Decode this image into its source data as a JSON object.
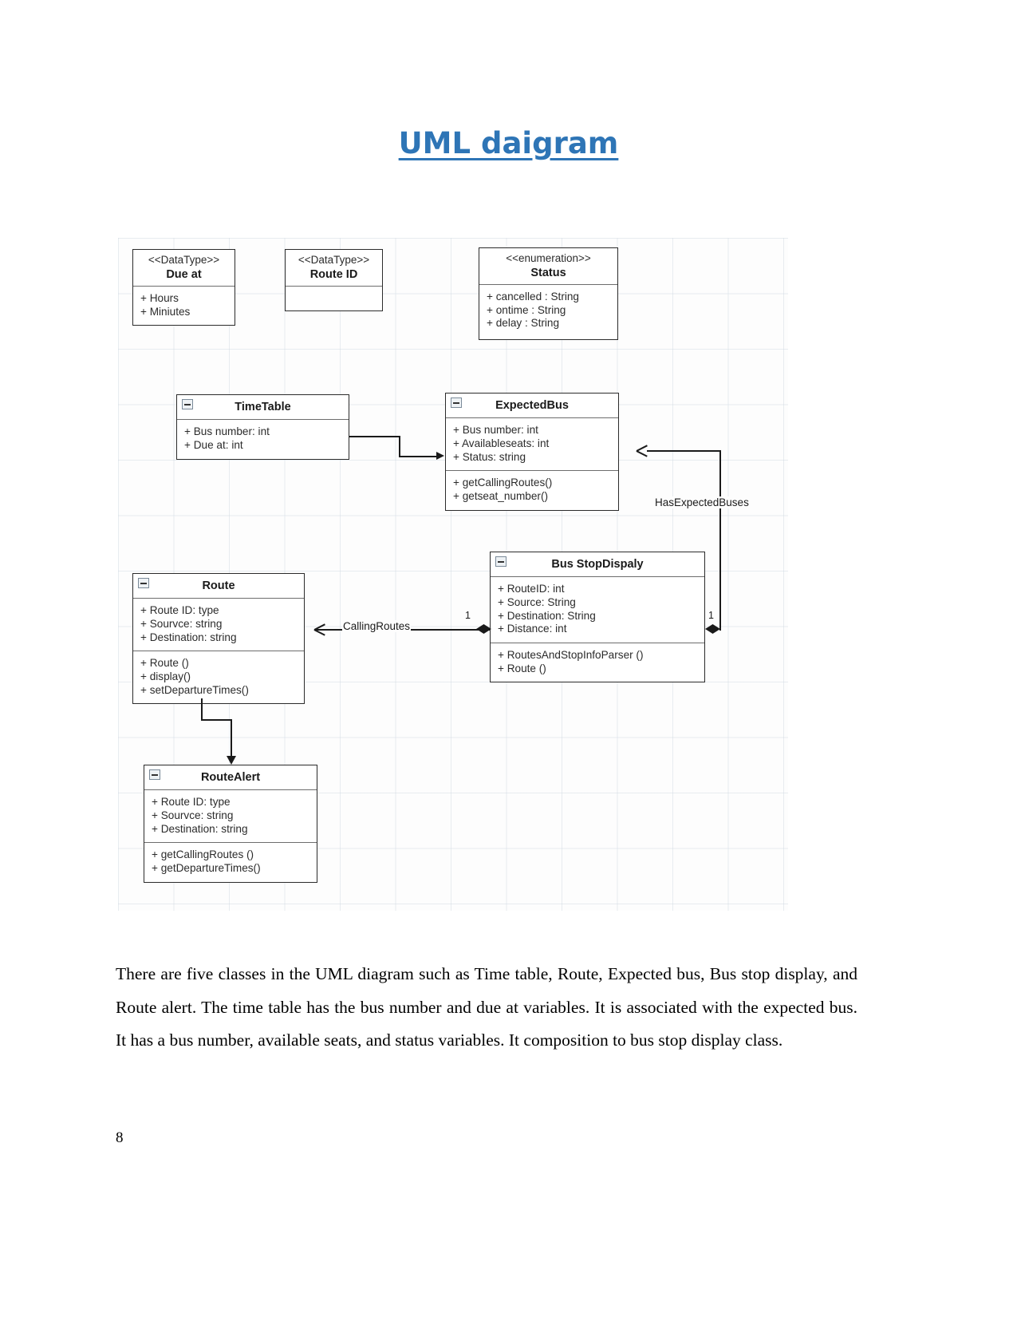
{
  "document": {
    "title": "UML daigram",
    "page_number": "8",
    "paragraph": "There are five classes in the UML diagram such as Time table, Route, Expected bus, Bus stop display, and Route alert. The time table has the bus number and due at variables. It is associated with the expected bus. It has a bus number, available seats, and status variables. It composition to bus stop display class.",
    "title_color": "#2E75B6"
  },
  "diagram": {
    "classes": [
      {
        "id": "dueat",
        "stereotype": "<<DataType>>",
        "name": "Due at",
        "attributes": [
          "+ Hours",
          "+ Miniutes"
        ],
        "methods": []
      },
      {
        "id": "routeid",
        "stereotype": "<<DataType>>",
        "name": "Route ID",
        "attributes": [],
        "methods": []
      },
      {
        "id": "status",
        "stereotype": "<<enumeration>>",
        "name": "Status",
        "attributes": [
          "+ cancelled : String",
          "+ ontime : String",
          "+ delay : String"
        ],
        "methods": []
      },
      {
        "id": "timetable",
        "stereotype": "",
        "name": "TimeTable",
        "attributes": [
          "+ Bus number: int",
          "+ Due at: int"
        ],
        "methods": []
      },
      {
        "id": "expectedbus",
        "stereotype": "",
        "name": "ExpectedBus",
        "attributes": [
          "+ Bus number: int",
          "+ Availableseats: int",
          "+ Status: string"
        ],
        "methods": [
          "+ getCallingRoutes()",
          "+ getseat_number()"
        ]
      },
      {
        "id": "busstopdispaly",
        "stereotype": "",
        "name": "Bus StopDispaly",
        "attributes": [
          "+ RouteID: int",
          "+ Source: String",
          "+ Destination: String",
          "+ Distance: int"
        ],
        "methods": [
          "+ RoutesAndStopInfoParser ()",
          "+ Route ()"
        ]
      },
      {
        "id": "route",
        "stereotype": "",
        "name": "Route",
        "attributes": [
          "+ Route ID: type",
          "+ Sourvce: string",
          "+ Destination: string"
        ],
        "methods": [
          "+ Route ()",
          "+ display()",
          "+ setDepartureTimes()"
        ]
      },
      {
        "id": "routealert",
        "stereotype": "",
        "name": "RouteAlert",
        "attributes": [
          "+ Route ID: type",
          "+ Sourvce: string",
          "+ Destination: string"
        ],
        "methods": [
          "+ getCallingRoutes ()",
          "+ getDepartureTimes()"
        ]
      }
    ],
    "relationships": [
      {
        "id": "callingroutes",
        "label": "CallingRoutes",
        "multiplicity": "1"
      },
      {
        "id": "hasexpectedbuses",
        "label": "HasExpectedBuses",
        "multiplicity": "1"
      }
    ]
  }
}
